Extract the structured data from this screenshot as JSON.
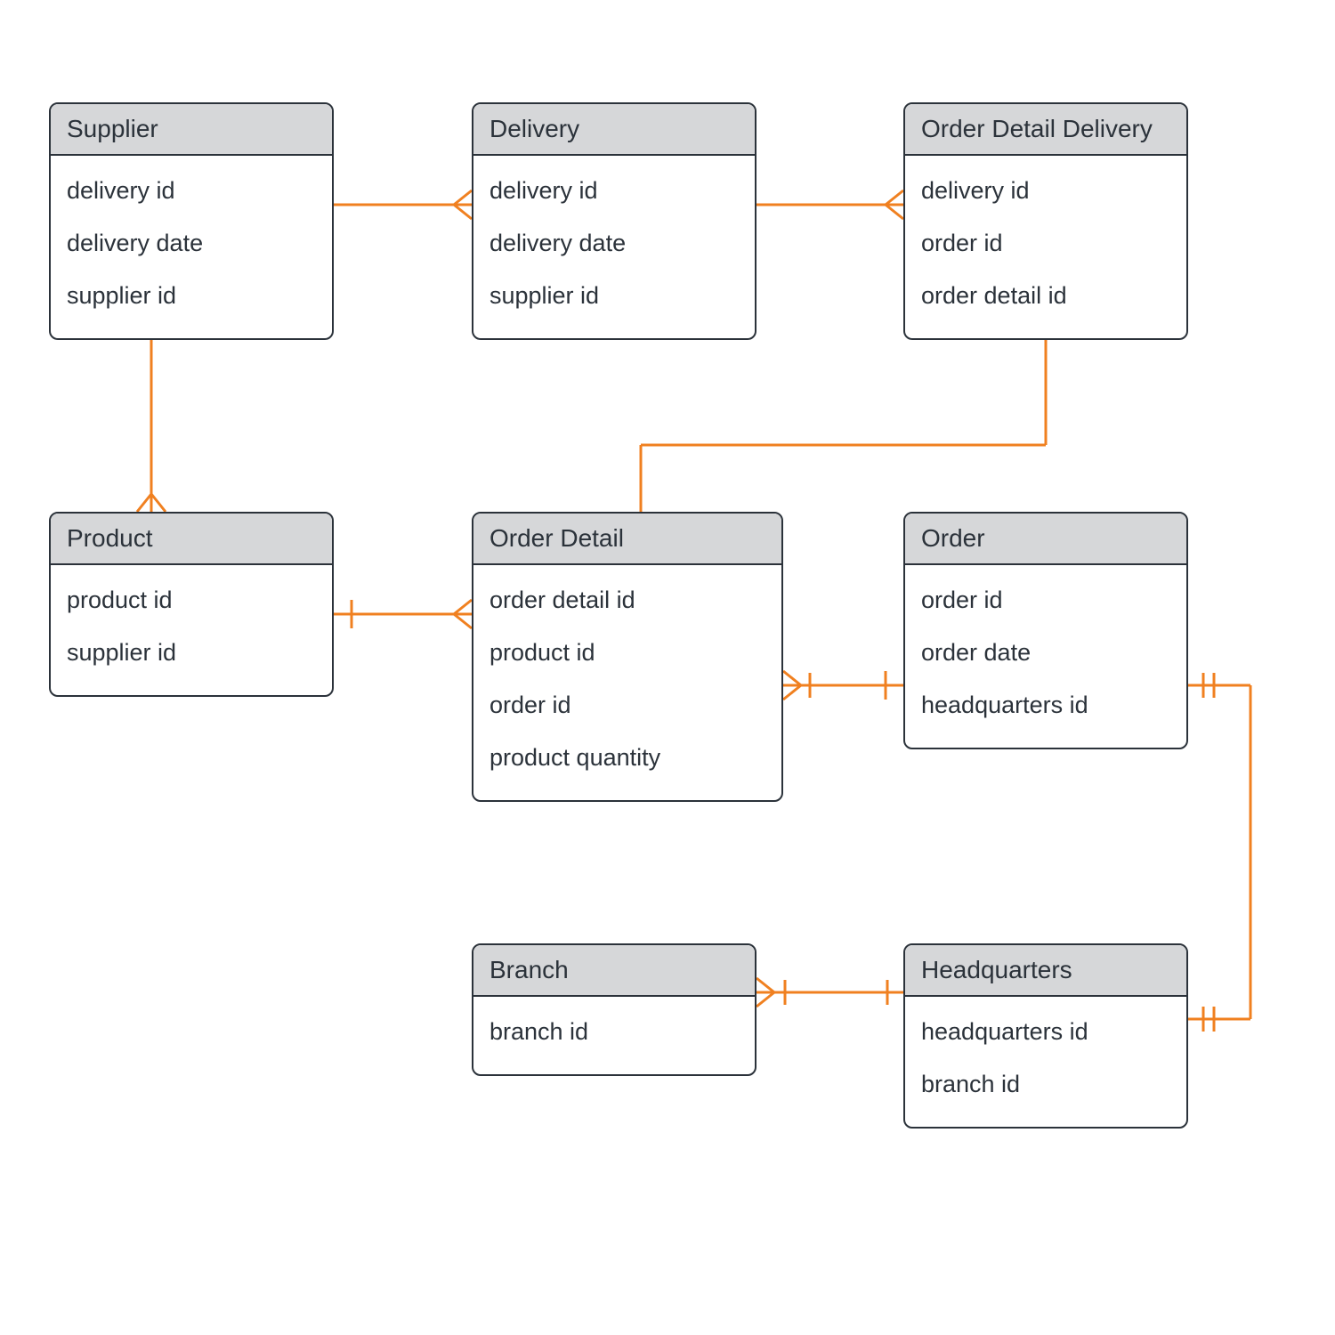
{
  "diagram_type": "entity-relationship",
  "colors": {
    "connector": "#f08020",
    "header_bg": "#d6d7d9",
    "border": "#2b323a"
  },
  "entities": {
    "supplier": {
      "name": "Supplier",
      "attrs": [
        "delivery id",
        "delivery date",
        "supplier id"
      ]
    },
    "delivery": {
      "name": "Delivery",
      "attrs": [
        "delivery id",
        "delivery date",
        "supplier id"
      ]
    },
    "order_detail_delivery": {
      "name": "Order Detail Delivery",
      "attrs": [
        "delivery id",
        "order id",
        "order detail id"
      ]
    },
    "product": {
      "name": "Product",
      "attrs": [
        "product id",
        "supplier id"
      ]
    },
    "order_detail": {
      "name": "Order Detail",
      "attrs": [
        "order detail id",
        "product id",
        "order id",
        "product quantity"
      ]
    },
    "order": {
      "name": "Order",
      "attrs": [
        "order id",
        "order date",
        "headquarters id"
      ]
    },
    "branch": {
      "name": "Branch",
      "attrs": [
        "branch id"
      ]
    },
    "headquarters": {
      "name": "Headquarters",
      "attrs": [
        "headquarters id",
        "branch id"
      ]
    }
  },
  "relationships": [
    {
      "from": "supplier",
      "to": "delivery",
      "cardinality": "one-to-many"
    },
    {
      "from": "delivery",
      "to": "order_detail_delivery",
      "cardinality": "one-to-many"
    },
    {
      "from": "supplier",
      "to": "product",
      "cardinality": "one-to-many"
    },
    {
      "from": "product",
      "to": "order_detail",
      "cardinality": "one-to-many"
    },
    {
      "from": "order",
      "to": "order_detail",
      "cardinality": "one-to-many"
    },
    {
      "from": "order_detail_delivery",
      "to": "order_detail",
      "cardinality": "many-to-one"
    },
    {
      "from": "order",
      "to": "headquarters",
      "cardinality": "one-to-one"
    },
    {
      "from": "headquarters",
      "to": "branch",
      "cardinality": "one-to-many"
    }
  ]
}
